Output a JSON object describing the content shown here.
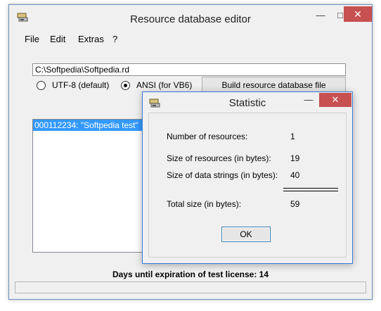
{
  "window": {
    "title": "Resource database editor",
    "minimize_glyph": "—",
    "maximize_glyph": "□",
    "close_glyph": "✕"
  },
  "menu": {
    "items": [
      {
        "label": "File"
      },
      {
        "label": "Edit"
      },
      {
        "label": "Extras"
      },
      {
        "label": "?"
      }
    ]
  },
  "form": {
    "path_value": "C:\\Softpedia\\Softpedia.rd",
    "encoding_options": [
      {
        "label": "UTF-8 (default)",
        "selected": false
      },
      {
        "label": "ANSI (for VB6)",
        "selected": true
      }
    ],
    "build_button_label": "Build resource database file"
  },
  "resource_list": {
    "items": [
      {
        "text": "000112234: \"Softpedia test\"",
        "selected": true
      }
    ]
  },
  "expiry_text": "Days until expiration of test license: 14",
  "statistic_dialog": {
    "title": "Statistic",
    "minimize_glyph": "—",
    "close_glyph": "✕",
    "rows": [
      {
        "label": "Number of resources:",
        "value": "1"
      },
      {
        "label": "Size of resources (in bytes):",
        "value": "19"
      },
      {
        "label": "Size of data strings (in bytes):",
        "value": "40"
      },
      {
        "label": "Total size (in bytes):",
        "value": "59"
      }
    ],
    "ok_label": "OK"
  },
  "icons": {
    "app_icon": "database-drive-icon",
    "dialog_icon": "database-drive-icon"
  },
  "colors": {
    "selection": "#3399ff",
    "close_button": "#c75050",
    "window_border": "#6d8fb8",
    "dialog_border": "#3b7bd8"
  }
}
